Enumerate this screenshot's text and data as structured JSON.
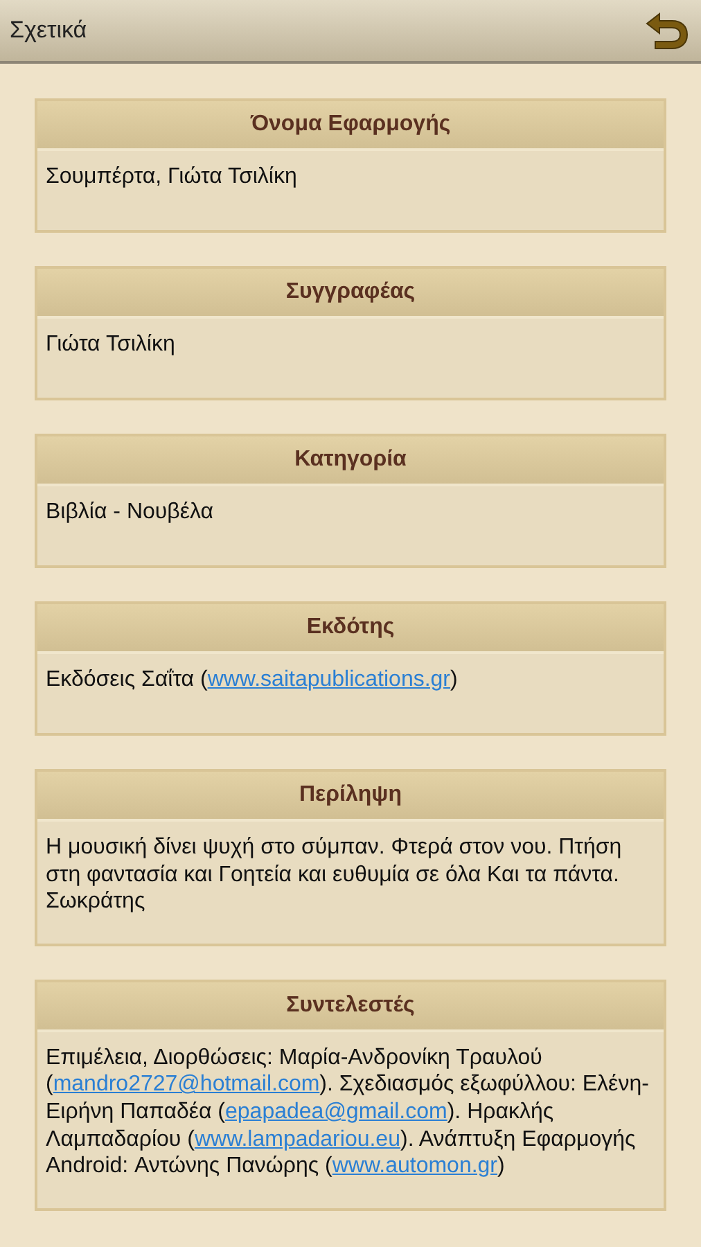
{
  "action_bar": {
    "title": "Σχετικά"
  },
  "cards": [
    {
      "heading": "Όνομα Εφαρμογής",
      "body": [
        {
          "kind": "text",
          "text": "Σουμπέρτα, Γιώτα Τσιλίκη"
        }
      ]
    },
    {
      "heading": "Συγγραφέας",
      "body": [
        {
          "kind": "text",
          "text": "Γιώτα Τσιλίκη"
        }
      ]
    },
    {
      "heading": "Κατηγορία",
      "body": [
        {
          "kind": "text",
          "text": "Βιβλία - Νουβέλα"
        }
      ]
    },
    {
      "heading": "Εκδότης",
      "body": [
        {
          "kind": "text",
          "text": "Εκδόσεις Σαΐτα ("
        },
        {
          "kind": "link",
          "text": "www.saitapublications.gr"
        },
        {
          "kind": "text",
          "text": ")"
        }
      ]
    },
    {
      "heading": "Περίληψη",
      "body": [
        {
          "kind": "text",
          "text": "Η μουσική δίνει ψυχή στο σύμπαν. Φτερά στον νου. Πτήση στη φαντασία και Γοητεία και ευθυμία σε όλα Και τα πάντα. Σωκράτης"
        }
      ]
    },
    {
      "heading": "Συντελεστές",
      "body": [
        {
          "kind": "text",
          "text": "Επιμέλεια, Διορθώσεις: Μαρία-Ανδρονίκη Τραυλού ("
        },
        {
          "kind": "link",
          "text": "mandro2727@hotmail.com"
        },
        {
          "kind": "text",
          "text": "). Σχεδιασμός εξωφύλλου: Ελένη-Ειρήνη Παπαδέα ("
        },
        {
          "kind": "link",
          "text": "epapadea@gmail.com"
        },
        {
          "kind": "text",
          "text": "). Ηρακλής Λαμπαδαρίου ("
        },
        {
          "kind": "link",
          "text": "www.lampadariou.eu"
        },
        {
          "kind": "text",
          "text": "). Ανάπτυξη Εφαρμογής Android: Αντώνης Πανώρης ("
        },
        {
          "kind": "link",
          "text": "www.automon.gr"
        },
        {
          "kind": "text",
          "text": ")"
        }
      ]
    }
  ]
}
